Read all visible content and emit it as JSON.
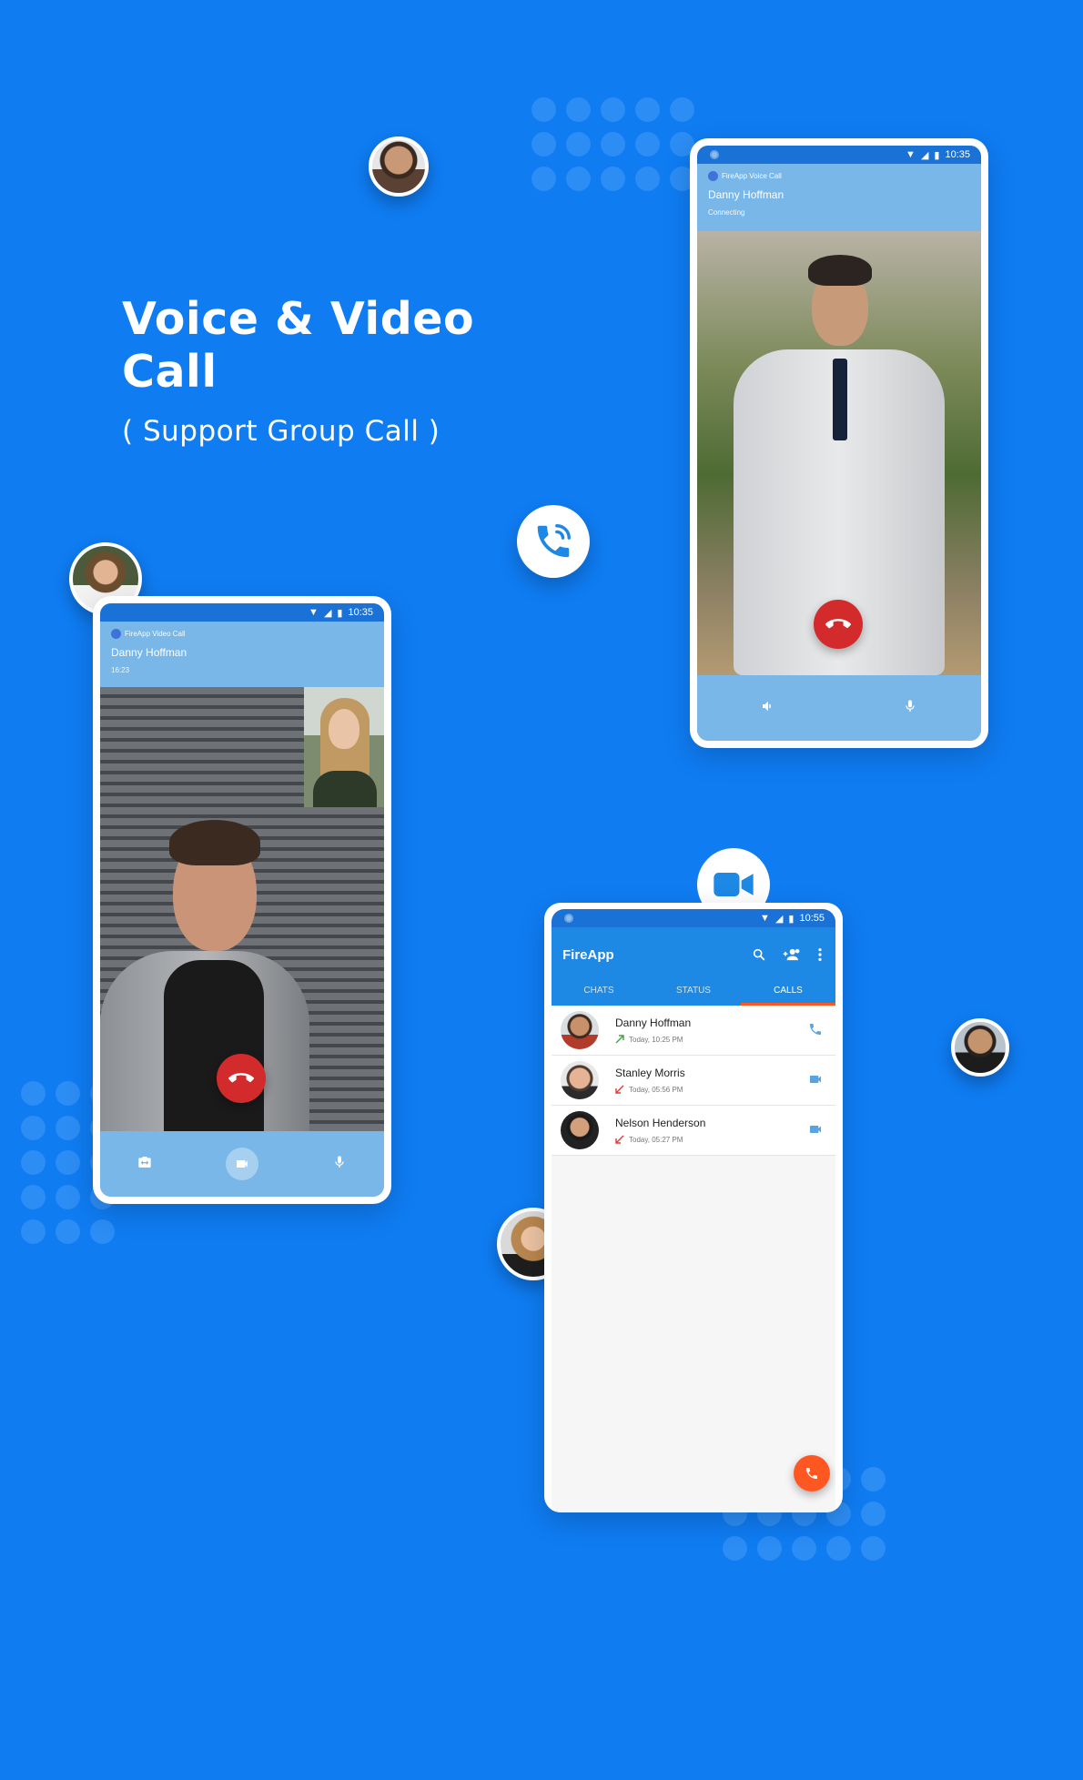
{
  "headline": {
    "line1": "Voice & Video",
    "line2": "Call",
    "subtitle": "( Support Group Call )"
  },
  "colors": {
    "background": "#0f7cf2",
    "accent_blue": "#1e88e5",
    "call_header": "#79b7e8",
    "hangup_red": "#d32b2b",
    "fab_orange": "#ff5722"
  },
  "voice_call_screen": {
    "status_time": "10:35",
    "app_label": "FireApp Voice Call",
    "caller_name": "Danny Hoffman",
    "call_status": "Connecting",
    "controls": [
      "speaker-icon",
      "mic-icon"
    ]
  },
  "video_call_screen": {
    "status_time": "10:35",
    "app_label": "FireApp Video Call",
    "caller_name": "Danny Hoffman",
    "duration": "16:23",
    "controls": [
      "switch-camera-icon",
      "video-icon",
      "mic-icon"
    ]
  },
  "calls_screen": {
    "status_time": "10:55",
    "app_title": "FireApp",
    "tabs": [
      {
        "label": "CHATS",
        "active": false
      },
      {
        "label": "STATUS",
        "active": false
      },
      {
        "label": "CALLS",
        "active": true
      }
    ],
    "calls": [
      {
        "name": "Danny Hoffman",
        "time": "Today, 10:25 PM",
        "direction": "outgoing",
        "type": "voice"
      },
      {
        "name": "Stanley Morris",
        "time": "Today, 05:56 PM",
        "direction": "missed",
        "type": "video"
      },
      {
        "name": "Nelson Henderson",
        "time": "Today, 05:27 PM",
        "direction": "missed",
        "type": "video"
      }
    ]
  }
}
